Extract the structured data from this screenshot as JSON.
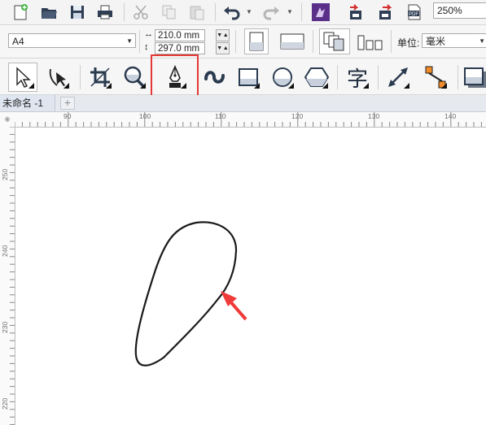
{
  "standard_toolbar": {
    "icons": [
      "new-document-icon",
      "open-folder-icon",
      "save-icon",
      "print-icon",
      "cut-icon",
      "copy-icon",
      "paste-icon",
      "undo-icon",
      "redo-icon",
      "launcher-icon",
      "import-icon",
      "export-icon",
      "publish-pdf-icon"
    ],
    "zoom_value": "250%"
  },
  "property_bar": {
    "page_size": "A4",
    "width": "210.0 mm",
    "height": "297.0 mm",
    "units_label": "单位:",
    "units_value": "毫米"
  },
  "toolbox": {
    "tools": [
      "pick-tool-icon",
      "shape-tool-icon",
      "crop-tool-icon",
      "zoom-tool-icon",
      "pen-tool-icon",
      "artistic-media-tool-icon",
      "rectangle-tool-icon",
      "ellipse-tool-icon",
      "polygon-tool-icon",
      "text-tool-icon",
      "dimension-tool-icon",
      "connector-tool-icon",
      "drop-shadow-tool-icon"
    ],
    "text_tool_glyph": "字",
    "highlighted_tool": "pen-tool"
  },
  "document_tabs": {
    "active_tab": "未命名 -1",
    "add_tab_glyph": "+"
  },
  "ruler": {
    "horizontal_labels": [
      "90",
      "100",
      "110",
      "120",
      "130",
      "140"
    ],
    "vertical_labels": [
      "250",
      "240",
      "230",
      "220"
    ]
  },
  "colors": {
    "highlight": "#e53935",
    "arrow": "#ef3b39",
    "stroke": "#1a1a1a"
  }
}
